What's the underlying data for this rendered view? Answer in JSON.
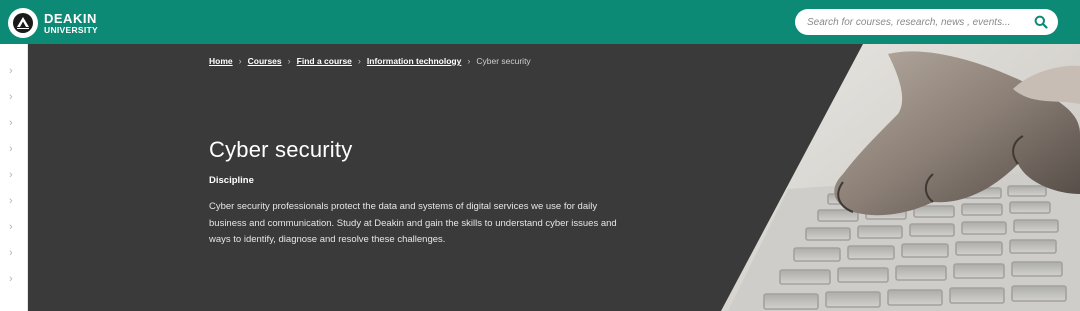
{
  "header": {
    "logo": {
      "line1": "DEAKIN",
      "line2": "UNIVERSITY",
      "icon": "deakin-logo-icon"
    },
    "search": {
      "placeholder": "Search for courses, research, news , events...",
      "icon": "search-icon"
    },
    "colors": {
      "brand": "#0d8a76"
    }
  },
  "breadcrumb": {
    "items": [
      "Home",
      "Courses",
      "Find a course",
      "Information technology"
    ],
    "current": "Cyber security",
    "separator": "›"
  },
  "hero": {
    "title": "Cyber security",
    "subtitle": "Discipline",
    "description": "Cyber security professionals protect the data and systems of digital services we use for daily business and communication. Study at Deakin and gain the skills to understand cyber issues and ways to identify, diagnose and resolve these challenges.",
    "background": "#3a3a3a",
    "image": "hand-typing-on-keyboard"
  },
  "rail": {
    "chevron": "›",
    "icon": "chevron-right-icon"
  }
}
